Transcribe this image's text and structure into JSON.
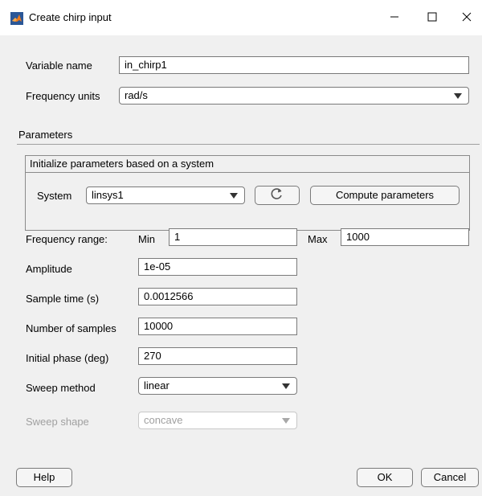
{
  "window": {
    "title": "Create chirp input"
  },
  "form": {
    "variable_name_label": "Variable name",
    "variable_name_value": "in_chirp1",
    "frequency_units_label": "Frequency units",
    "frequency_units_value": "rad/s"
  },
  "parameters": {
    "section_label": "Parameters",
    "group_title": "Initialize parameters based on a system",
    "system_label": "System",
    "system_value": "linsys1",
    "compute_button": "Compute parameters",
    "frequency_range_label": "Frequency range:",
    "min_label": "Min",
    "min_value": "1",
    "max_label": "Max",
    "max_value": "1000",
    "amplitude_label": "Amplitude",
    "amplitude_value": "1e-05",
    "sample_time_label": "Sample time (s)",
    "sample_time_value": "0.0012566",
    "num_samples_label": "Number of samples",
    "num_samples_value": "10000",
    "initial_phase_label": "Initial phase (deg)",
    "initial_phase_value": "270",
    "sweep_method_label": "Sweep method",
    "sweep_method_value": "linear",
    "sweep_shape_label": "Sweep shape",
    "sweep_shape_value": "concave"
  },
  "footer": {
    "help": "Help",
    "ok": "OK",
    "cancel": "Cancel"
  },
  "icons": {
    "app": "matlab-icon",
    "refresh": "refresh-icon",
    "minimize": "minimize-icon",
    "maximize": "maximize-icon",
    "close": "close-icon"
  }
}
